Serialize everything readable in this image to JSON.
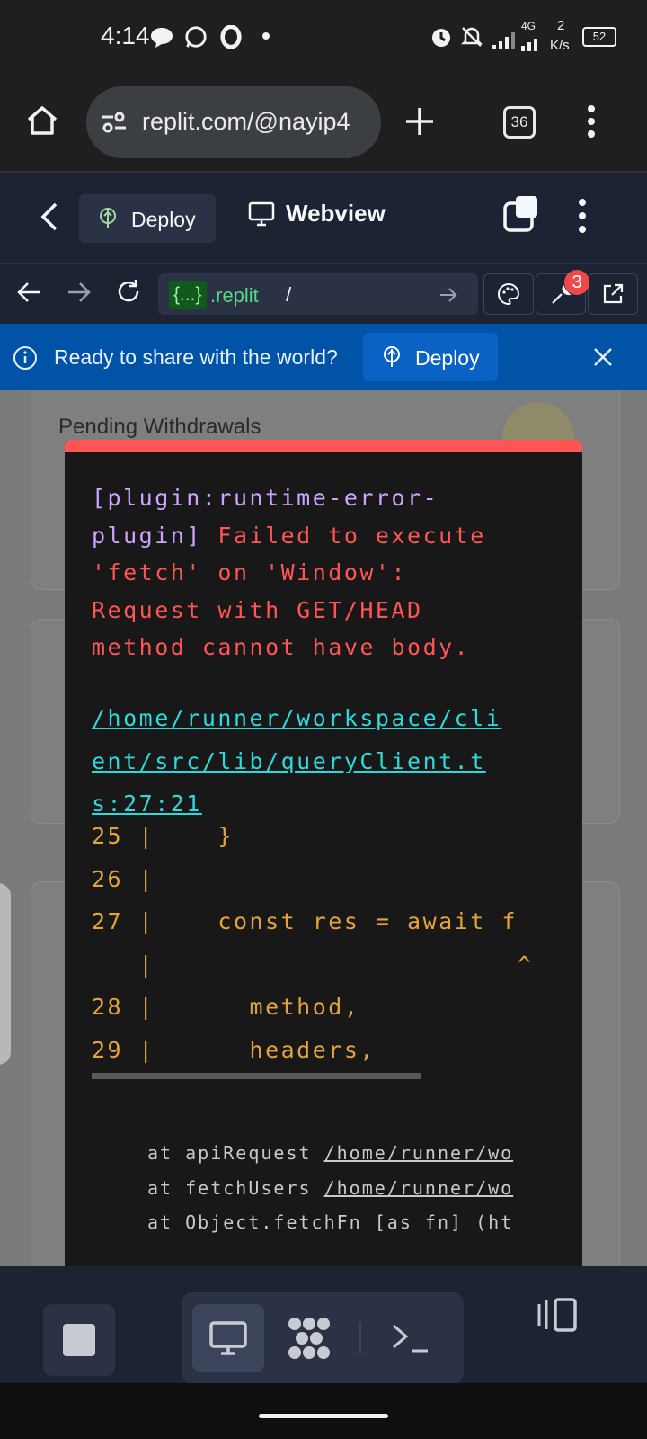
{
  "status_bar": {
    "time": "4:14",
    "network": "4G",
    "speed_value": "2",
    "speed_unit": "K/s",
    "battery": "52"
  },
  "browser": {
    "url": "replit.com/@nayip4",
    "tab_count": "36"
  },
  "replit_header": {
    "deploy_tab": "Deploy",
    "webview_tab": "Webview"
  },
  "nav": {
    "chip": "{...}",
    "domain": ".replit",
    "path": "/",
    "notification_count": "3"
  },
  "banner": {
    "message": "Ready to share with the world?",
    "deploy_button": "Deploy"
  },
  "background": {
    "card1_title": "Pending Withdrawals"
  },
  "error_overlay": {
    "plugin_line1": "[plugin:runtime-error-",
    "plugin_line2": "plugin]",
    "msg_line2": " Failed to execute",
    "msg_line3": "'fetch' on 'Window':",
    "msg_line4": "Request with GET/HEAD",
    "msg_line5": "method cannot have body.",
    "path_lines": [
      "/home/runner/workspace/cli",
      "ent/src/lib/queryClient.t",
      "s:27:21"
    ],
    "code_lines": [
      "25 |    }",
      "26 |",
      "27 |    const res = await f",
      "   |                       ^",
      "28 |      method,",
      "29 |      headers,"
    ],
    "stack": [
      {
        "prefix": "at apiRequest ",
        "link": "/home/runner/wo"
      },
      {
        "prefix": "at fetchUsers ",
        "link": "/home/runner/wo"
      },
      {
        "prefix": "at Object.fetchFn [as fn] (ht",
        "link": ""
      }
    ]
  },
  "colors": {
    "accent_error": "#ff5555",
    "banner_bg": "#0053a6",
    "link": "#2dd9da",
    "code": "#e3a33c"
  }
}
